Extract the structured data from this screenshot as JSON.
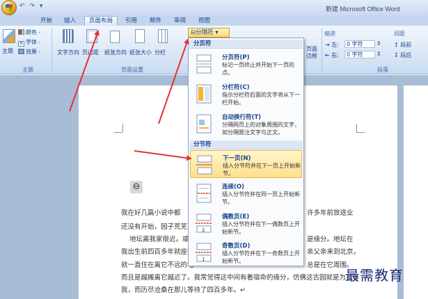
{
  "window": {
    "title": "新建 Microsoft Office Word"
  },
  "quick_access": {
    "items": [
      "↶",
      "↷",
      "▾"
    ]
  },
  "tabs": [
    {
      "label": "开始"
    },
    {
      "label": "插入"
    },
    {
      "label": "页面布局",
      "active": true
    },
    {
      "label": "引用"
    },
    {
      "label": "邮件"
    },
    {
      "label": "审阅"
    },
    {
      "label": "视图"
    }
  ],
  "ribbon": {
    "theme_group": {
      "label": "主题",
      "theme_button": "主题",
      "colors": "颜色 -",
      "fonts": "字体 -",
      "effects": "效果 -"
    },
    "page_setup_group": {
      "label": "页面设置",
      "text_direction": "文字方向",
      "margins": "页边距",
      "orientation": "纸张方向",
      "size": "纸张大小",
      "columns": "分栏",
      "breaks": "分隔符"
    },
    "paragraph_group": {
      "label": "段落",
      "indent_header": "缩进",
      "spacing_header": "间距",
      "left_label": "左:",
      "left_value": "0 字符",
      "right_label": "右:",
      "right_value": "0 字符",
      "before_label": "段前",
      "after_label": "段后"
    },
    "arrange_partial": {
      "label1": "页面",
      "label2": "边框"
    }
  },
  "breaks_menu": {
    "page_breaks_header": "分页符",
    "section_breaks_header": "分节符",
    "items": [
      {
        "title": "分页符(P)",
        "desc": "标记一页终止并开始下一页的点。"
      },
      {
        "title": "分栏符(C)",
        "desc": "指示分栏符后面的文字将从下一栏开始。"
      },
      {
        "title": "自动换行符(T)",
        "desc": "分隔网页上的对象周围的文字，如分隔题注文字与正文。"
      },
      {
        "title": "下一页(N)",
        "desc": "插入分节符并在下一页上开始新节。",
        "highlighted": true
      },
      {
        "title": "连续(O)",
        "desc": "插入分节符并在同一页上开始新节。"
      },
      {
        "title": "偶数页(E)",
        "desc": "插入分节符并在下一偶数页上开始新节。"
      },
      {
        "title": "奇数页(D)",
        "desc": "插入分节符并在下一奇数页上开始新节。"
      }
    ]
  },
  "document": {
    "paragraph_mark": "⊖",
    "lines": [
      {
        "left": "我在好几篇小说中都",
        "right": "许多年前旅途业"
      },
      {
        "left": "还没有开始，园子荒芜冷",
        "right": ""
      },
      {
        "left": "地坛离我家很近。或",
        "right": "是缘分。地坛在"
      },
      {
        "left": "我出生前四百多年就座落",
        "right": "亲父亲来到北京，"
      },
      {
        "left": "就一直住在离它不远的地",
        "right": "总是在它周围。"
      },
      {
        "left": "而且是越搬离它越近了。我常觉得这中间有着宿命的缘分，仿佛这古园就是为了等",
        "right": ""
      },
      {
        "left": "我，而历尽沧桑在那儿等待了四百多年。↵",
        "right": ""
      }
    ]
  },
  "watermark": "最需教育",
  "colors": {
    "accent": "#15428b",
    "highlight": "#ffe08a",
    "arrow": "#e23232"
  }
}
